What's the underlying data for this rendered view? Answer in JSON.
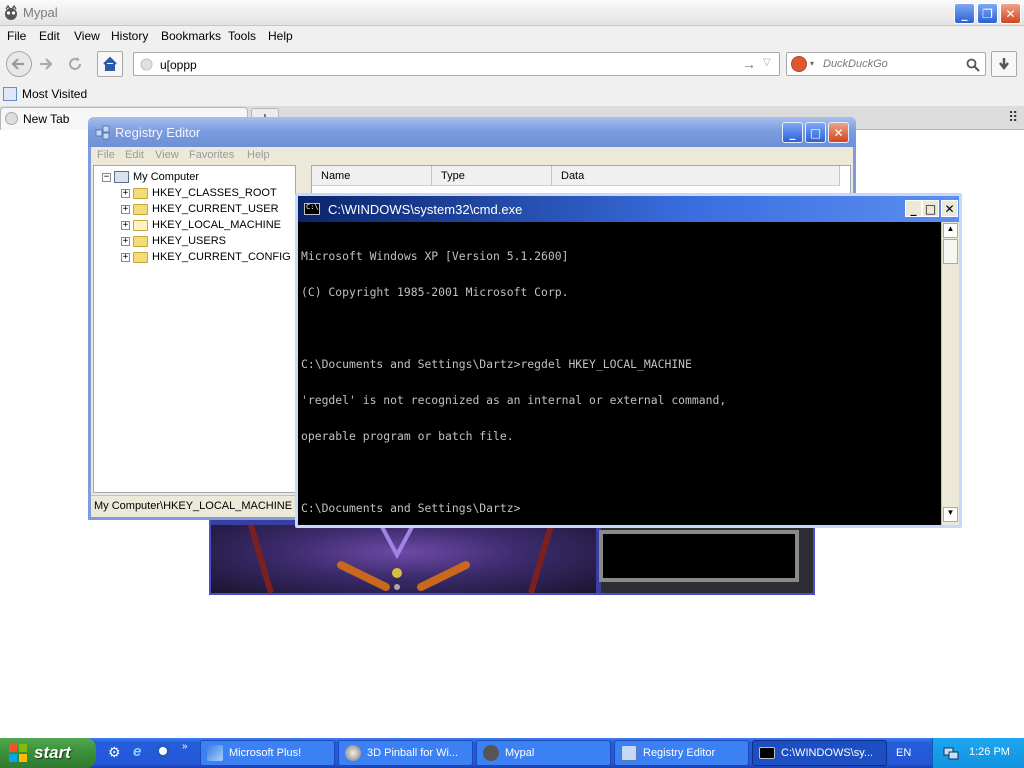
{
  "browser": {
    "title": "Mypal",
    "menu": [
      "File",
      "Edit",
      "View",
      "History",
      "Bookmarks",
      "Tools",
      "Help"
    ],
    "url_value": "u[oppp",
    "search_placeholder": "DuckDuckGo",
    "bookmarks": [
      "Most Visited"
    ],
    "tabs": [
      {
        "label": "New Tab"
      }
    ],
    "new_tab_button": "+"
  },
  "regedit": {
    "title": "Registry Editor",
    "menu": [
      "File",
      "Edit",
      "View",
      "Favorites",
      "Help"
    ],
    "tree_root": "My Computer",
    "tree_items": [
      "HKEY_CLASSES_ROOT",
      "HKEY_CURRENT_USER",
      "HKEY_LOCAL_MACHINE",
      "HKEY_USERS",
      "HKEY_CURRENT_CONFIG"
    ],
    "columns": [
      "Name",
      "Type",
      "Data"
    ],
    "status": "My Computer\\HKEY_LOCAL_MACHINE"
  },
  "cmd": {
    "title": "C:\\WINDOWS\\system32\\cmd.exe",
    "lines": [
      "Microsoft Windows XP [Version 5.1.2600]",
      "(C) Copyright 1985-2001 Microsoft Corp.",
      "",
      "C:\\Documents and Settings\\Dartz>regdel HKEY_LOCAL_MACHINE",
      "'regdel' is not recognized as an internal or external command,",
      "operable program or batch file.",
      "",
      "C:\\Documents and Settings\\Dartz>"
    ]
  },
  "taskbar": {
    "start_label": "start",
    "buttons": [
      {
        "label": "Microsoft Plus!",
        "icon": "microsoft-plus-icon"
      },
      {
        "label": "3D Pinball for Wi...",
        "icon": "pinball-icon"
      },
      {
        "label": "Mypal",
        "icon": "mypal-icon"
      },
      {
        "label": "Registry Editor",
        "icon": "regedit-icon"
      },
      {
        "label": "C:\\WINDOWS\\sy...",
        "icon": "cmd-icon"
      }
    ],
    "language": "EN",
    "clock": "1:26 PM"
  },
  "colors": {
    "xp_taskbar": "#245edb",
    "start_green": "#3a8f3a",
    "regedit_title_inactive": "#7d9de0",
    "cmd_title_active": "#0a246a"
  }
}
